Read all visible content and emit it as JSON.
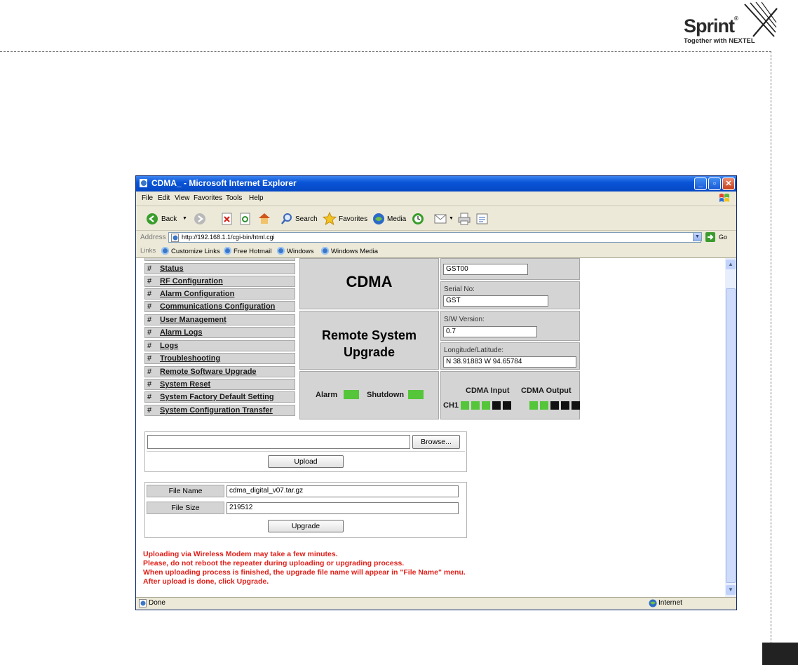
{
  "brand": {
    "name": "Sprint",
    "tagline": "Together with NEXTEL"
  },
  "browser": {
    "title": "CDMA_ - Microsoft Internet Explorer",
    "menu": [
      "File",
      "Edit",
      "View",
      "Favorites",
      "Tools",
      "Help"
    ],
    "toolbar": {
      "back": "Back",
      "search": "Search",
      "favorites": "Favorites",
      "media": "Media"
    },
    "address_label": "Address",
    "address_url": "http://192.168.1.1/cgi-bin/html.cgi",
    "go_label": "Go",
    "links_label": "Links",
    "links": [
      "Customize Links",
      "Free Hotmail",
      "Windows",
      "Windows Media"
    ],
    "status": "Done",
    "zone": "Internet"
  },
  "nav": [
    {
      "hash": "#",
      "label": "Status"
    },
    {
      "hash": "#",
      "label": "RF Configuration"
    },
    {
      "hash": "#",
      "label": "Alarm Configuration"
    },
    {
      "hash": "#",
      "label": "Communications Configuration"
    },
    {
      "hash": "#",
      "label": "User Management"
    },
    {
      "hash": "#",
      "label": "Alarm Logs"
    },
    {
      "hash": "#",
      "label": "Logs"
    },
    {
      "hash": "#",
      "label": "Troubleshooting"
    },
    {
      "hash": "#",
      "label": "Remote Software Upgrade"
    },
    {
      "hash": "#",
      "label": "System Reset"
    },
    {
      "hash": "#",
      "label": "System Factory Default Setting"
    },
    {
      "hash": "#",
      "label": "System Configuration Transfer"
    }
  ],
  "header": {
    "product": "CDMA",
    "page_title_line1": "Remote System",
    "page_title_line2": "Upgrade"
  },
  "info": {
    "site_code_value": "GST00",
    "serial_label": "Serial No:",
    "serial_value": "GST",
    "sw_label": "S/W Version:",
    "sw_value": "0.7",
    "lonlat_label": "Longitude/Latitude:",
    "lonlat_value": "N 38.91883 W 94.65784"
  },
  "indicators": {
    "alarm_label": "Alarm",
    "shutdown_label": "Shutdown",
    "input_label": "CDMA Input",
    "output_label": "CDMA Output",
    "channel_label": "CH1",
    "input_leds": [
      true,
      true,
      true,
      false,
      false
    ],
    "output_leds": [
      true,
      true,
      false,
      false,
      false
    ]
  },
  "upload": {
    "browse_label": "Browse...",
    "upload_label": "Upload"
  },
  "upgrade": {
    "file_name_label": "File Name",
    "file_name_value": "cdma_digital_v07.tar.gz",
    "file_size_label": "File Size",
    "file_size_value": "219512",
    "upgrade_label": "Upgrade"
  },
  "messages": [
    "Uploading via Wireless Modem may take a few minutes.",
    "Please, do not reboot the repeater during uploading or upgrading process.",
    "When uploading process is finished, the upgrade file name will appear in \"File Name\" menu.",
    "After upload is done, click Upgrade."
  ],
  "colors": {
    "warning": "#e0201a",
    "led_on": "#55c53a",
    "led_off": "#111111",
    "titlebar": "#0a55d8"
  }
}
